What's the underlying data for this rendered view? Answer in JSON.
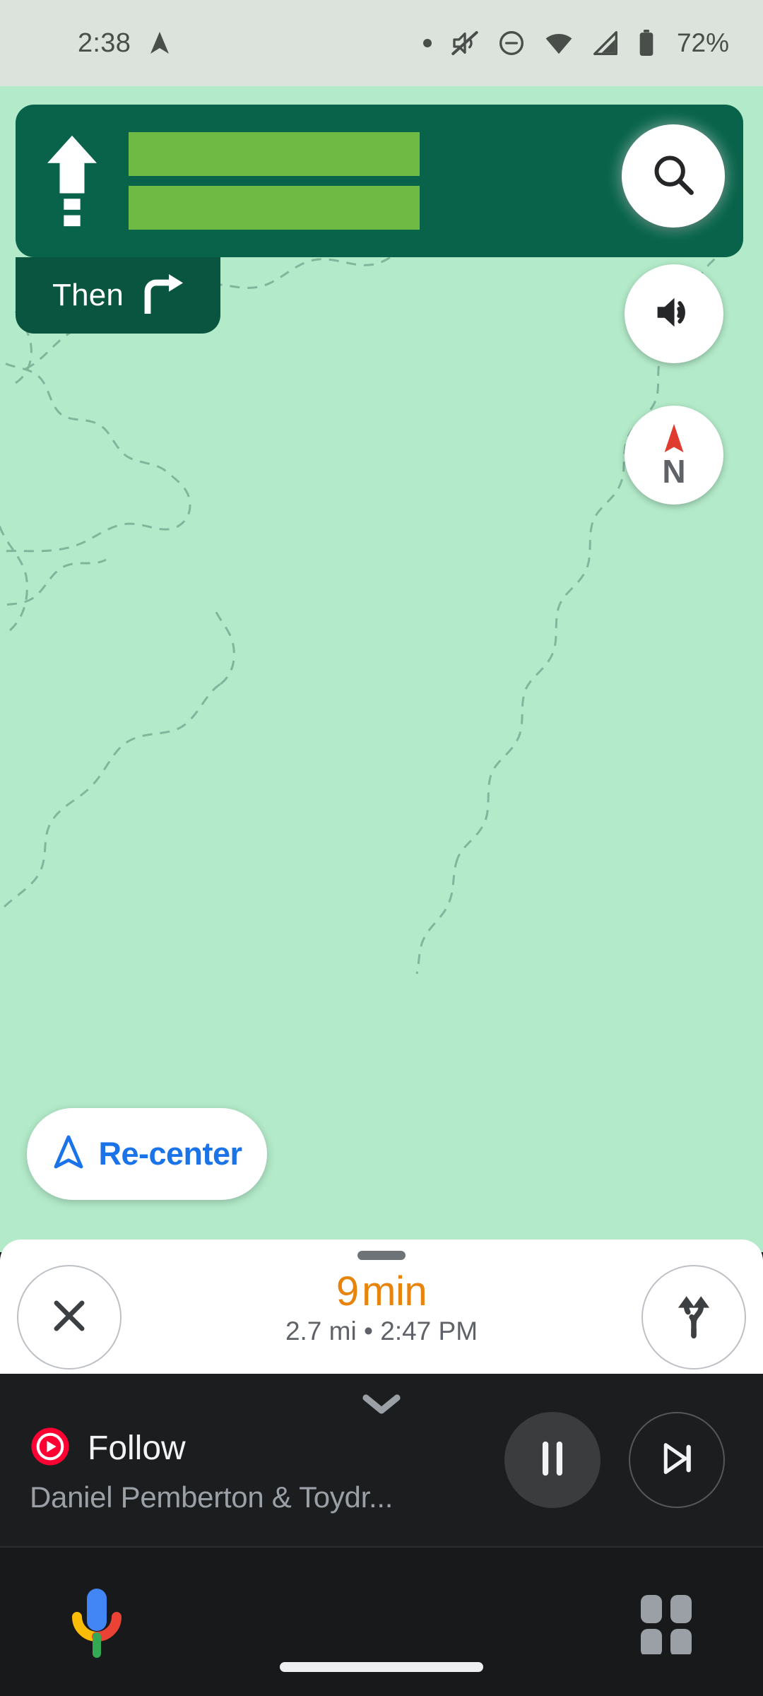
{
  "status_bar": {
    "time": "2:38",
    "location_icon": "location-arrow-icon",
    "icons": [
      "dot-indicator-icon",
      "vibrate-off-icon",
      "do-not-disturb-icon",
      "wifi-icon",
      "cellular-signal-icon",
      "battery-icon"
    ],
    "battery_percent": "72%"
  },
  "navigation": {
    "maneuver_icon": "straight-ahead-arrow-icon",
    "street_redacted": [
      "",
      ""
    ],
    "then_label": "Then",
    "then_icon": "turn-right-icon",
    "card_color": "#08634A",
    "then_card_color": "#0A5540",
    "redact_color": "#6FBA44"
  },
  "map": {
    "background_color": "#B3EBCA",
    "trail_color": "#6FA48C"
  },
  "fabs": {
    "search": "search-icon",
    "sound": "volume-on-icon",
    "compass_label": "N",
    "compass_needle_color": "#E03B2F"
  },
  "recenter": {
    "label": "Re-center",
    "icon": "navigation-arrow-icon",
    "color": "#1A73E8"
  },
  "eta": {
    "duration_value": "9",
    "duration_unit": "min",
    "duration_color": "#E8830C",
    "distance": "2.7 mi",
    "separator": "•",
    "arrival_time": "2:47 PM",
    "close_icon": "close-x-icon",
    "routes_icon": "route-alternatives-icon"
  },
  "media": {
    "collapse_icon": "chevron-down-icon",
    "app_icon": "youtube-music-icon",
    "title": "Follow",
    "artist": "Daniel Pemberton & Toydr...",
    "pause_icon": "pause-icon",
    "next_icon": "skip-next-icon"
  },
  "system_nav": {
    "assistant_icon": "google-assistant-mic-icon",
    "apps_icon": "apps-grid-icon",
    "home_indicator": "home-indicator-bar"
  }
}
